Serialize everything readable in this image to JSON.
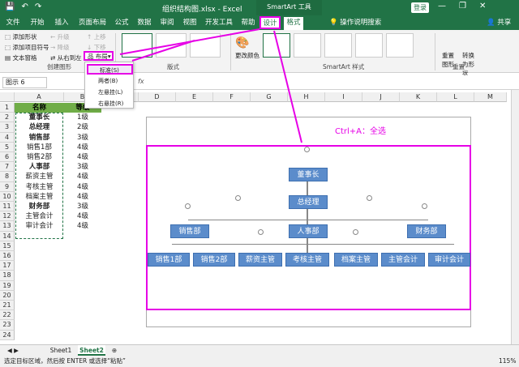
{
  "titlebar": {
    "save_glyph": "💾",
    "undo_glyph": "↶",
    "redo_glyph": "↷",
    "doc_title": "组织结构图.xlsx - Excel",
    "context_title": "SmartArt 工具",
    "login": "登录",
    "minimize": "—",
    "restore": "❐",
    "close": "✕"
  },
  "tabs": [
    "文件",
    "开始",
    "插入",
    "页面布局",
    "公式",
    "数据",
    "审阅",
    "视图",
    "开发工具",
    "帮助",
    "设计",
    "格式"
  ],
  "tab_search": "操作说明搜索",
  "share": "共享",
  "ribbon": {
    "add_shape": "添加形状",
    "add_bullet": "添加项目符号",
    "text_pane": "文本窗格",
    "promote": "升级",
    "demote": "降级",
    "right_to_left": "从右到左",
    "move_up": "上移",
    "move_down": "下移",
    "layout_btn": "布局",
    "create_graphic": "创建图形",
    "layouts": "版式",
    "change_colors": "更改颜色",
    "smartart_styles": "SmartArt 样式",
    "reset_graphic": "重置图形",
    "convert_shape": "转换为形状",
    "reset": "重置"
  },
  "layout_menu": [
    "标准(S)",
    "两者(B)",
    "左悬挂(L)",
    "右悬挂(R)"
  ],
  "namebox": "图示 6",
  "fx": "fx",
  "columns": [
    "A",
    "B",
    "C",
    "D",
    "E",
    "F",
    "G",
    "H",
    "I",
    "J",
    "K",
    "L",
    "M"
  ],
  "sheet": {
    "header": [
      "名称",
      "等级"
    ],
    "rows": [
      [
        "董事长",
        "1级",
        true
      ],
      [
        "总经理",
        "2级",
        true
      ],
      [
        "销售部",
        "3级",
        true
      ],
      [
        "销售1部",
        "4级",
        false
      ],
      [
        "销售2部",
        "4级",
        false
      ],
      [
        "人事部",
        "3级",
        true
      ],
      [
        "薪资主管",
        "4级",
        false
      ],
      [
        "考核主管",
        "4级",
        false
      ],
      [
        "档案主管",
        "4级",
        false
      ],
      [
        "财务部",
        "3级",
        true
      ],
      [
        "主管会计",
        "4级",
        false
      ],
      [
        "审计会计",
        "4级",
        false
      ]
    ]
  },
  "annotation": "Ctrl+A：全选",
  "org": {
    "top": "董事长",
    "second": "总经理",
    "depts": [
      "销售部",
      "人事部",
      "财务部"
    ],
    "subs": [
      "销售1部",
      "销售2部",
      "薪资主管",
      "考核主管",
      "档案主管",
      "主管会计",
      "审计会计"
    ]
  },
  "sheet_tabs": [
    "Sheet1",
    "Sheet2"
  ],
  "status": {
    "text": "选定目标区域，然后按 ENTER 或选择“粘贴”",
    "zoom": "115%"
  },
  "colors": {
    "excel_green": "#217346",
    "node": "#5b8ccb",
    "highlight": "#e600e6"
  }
}
